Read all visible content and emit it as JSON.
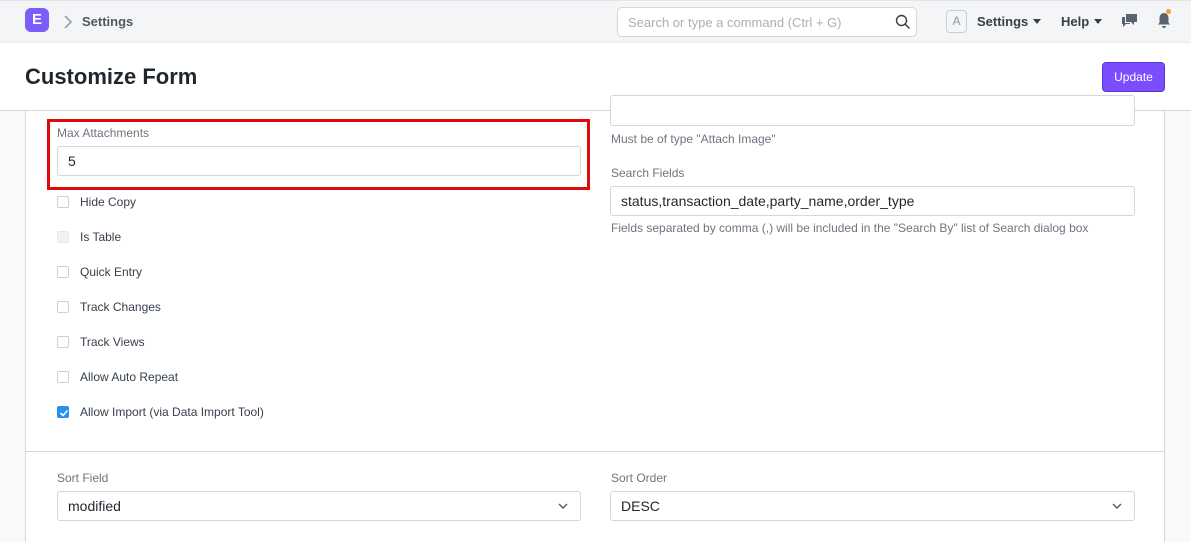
{
  "navbar": {
    "logo_letter": "E",
    "breadcrumb": "Settings",
    "search_placeholder": "Search or type a command (Ctrl + G)",
    "avatar_letter": "A",
    "settings_label": "Settings",
    "help_label": "Help",
    "notification_color": "#f7a12e"
  },
  "page": {
    "title": "Customize Form",
    "update_label": "Update"
  },
  "form": {
    "max_attachments": {
      "label": "Max Attachments",
      "value": "5"
    },
    "image_field_help": "Must be of type \"Attach Image\"",
    "search_fields": {
      "label": "Search Fields",
      "value": "status,transaction_date,party_name,order_type",
      "help": "Fields separated by comma (,) will be included in the \"Search By\" list of Search dialog box"
    },
    "checkboxes": [
      {
        "label": "Hide Copy",
        "checked": false,
        "disabled": false
      },
      {
        "label": "Is Table",
        "checked": false,
        "disabled": true
      },
      {
        "label": "Quick Entry",
        "checked": false,
        "disabled": false
      },
      {
        "label": "Track Changes",
        "checked": false,
        "disabled": false
      },
      {
        "label": "Track Views",
        "checked": false,
        "disabled": false
      },
      {
        "label": "Allow Auto Repeat",
        "checked": false,
        "disabled": false
      },
      {
        "label": "Allow Import (via Data Import Tool)",
        "checked": true,
        "disabled": false
      }
    ],
    "sort_field": {
      "label": "Sort Field",
      "value": "modified"
    },
    "sort_order": {
      "label": "Sort Order",
      "value": "DESC"
    }
  },
  "colors": {
    "primary": "#7c4dff",
    "checkbox_checked": "#2490ef",
    "highlight_border": "#e00a0a"
  }
}
